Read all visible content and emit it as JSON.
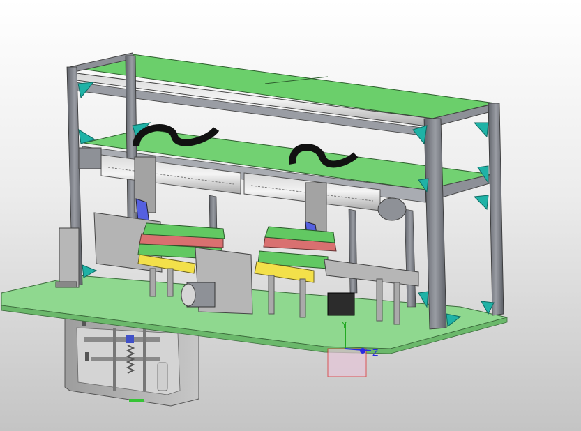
{
  "viewport": {
    "background_top": "#ffffff",
    "background_bottom": "#c4c4c4"
  },
  "model": {
    "frame_color": "#7c7f86",
    "panel_color": "#79d779",
    "base_plate_color": "#8fd88f",
    "bracket_color": "#1fb2a6",
    "cable_chain_color": "#111111",
    "stripe_red": "#d97070",
    "stripe_green": "#62c862",
    "clamp_yellow": "#f3e04a",
    "motor_color": "#9a9ca3",
    "cylinder_blue": "#5560e0",
    "cabinet_color": "#b9b9b9"
  },
  "triad": {
    "y_label": "Y",
    "z_label": "Z",
    "y_color": "#22aa22",
    "z_color": "#2a2ae0",
    "x_color": "#dd2222"
  }
}
